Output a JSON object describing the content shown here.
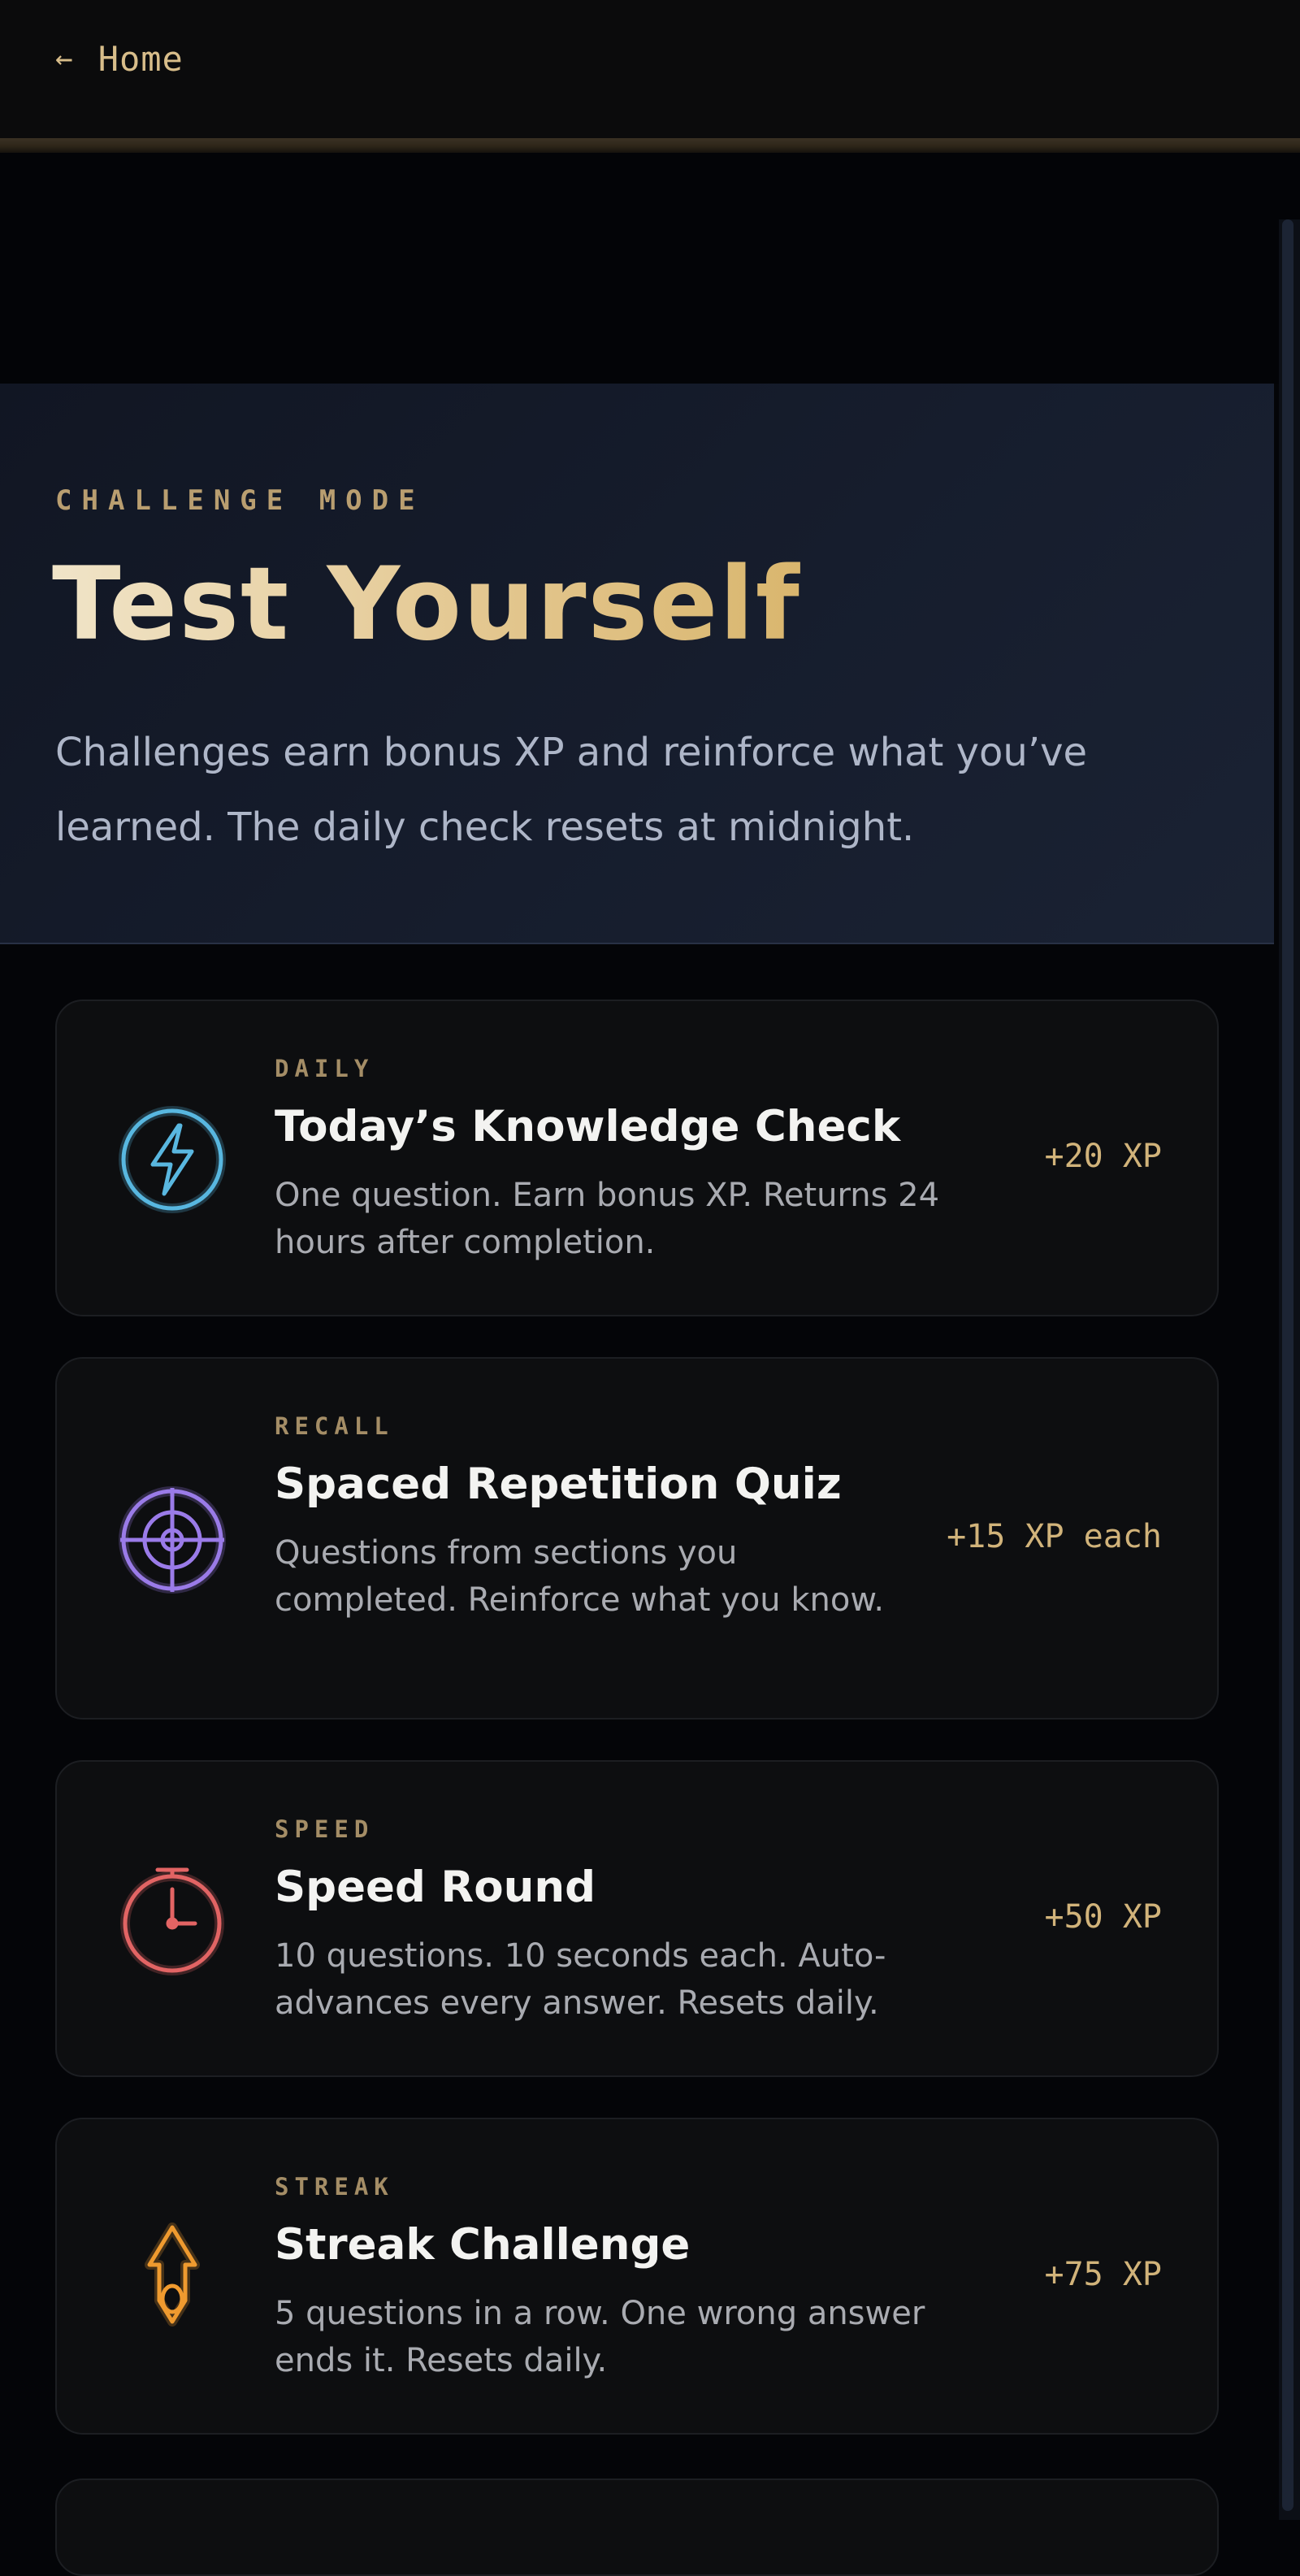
{
  "nav": {
    "back_arrow": "←",
    "back_label": "Home"
  },
  "hero": {
    "eyebrow": "CHALLENGE MODE",
    "title": "Test Yourself",
    "description": "Challenges earn bonus XP and reinforce what you’ve learned. The daily check resets at midnight."
  },
  "challenges": [
    {
      "tag": "DAILY",
      "title": "Today’s Knowledge Check",
      "description": "One question. Earn bonus XP. Returns 24 hours after completion.",
      "xp": "+20 XP",
      "icon": "lightning-icon",
      "color": "#59b7e0"
    },
    {
      "tag": "RECALL",
      "title": "Spaced Repetition Quiz",
      "description": "Questions from sections you completed. Reinforce what you know.",
      "xp": "+15 XP each",
      "icon": "target-icon",
      "color": "#9a7be8"
    },
    {
      "tag": "SPEED",
      "title": "Speed Round",
      "description": "10 questions. 10 seconds each. Auto-advances every answer. Resets daily.",
      "xp": "+50 XP",
      "icon": "timer-icon",
      "color": "#e26464"
    },
    {
      "tag": "STREAK",
      "title": "Streak Challenge",
      "description": "5 questions in a row. One wrong answer ends it. Resets daily.",
      "xp": "+75 XP",
      "icon": "flame-icon",
      "color": "#ef9a2f"
    }
  ],
  "colors": {
    "accent_gold": "#d8bd8a",
    "hero_bg": "#151b2a",
    "card_bg": "#0d0e10",
    "page_bg": "#040508"
  }
}
